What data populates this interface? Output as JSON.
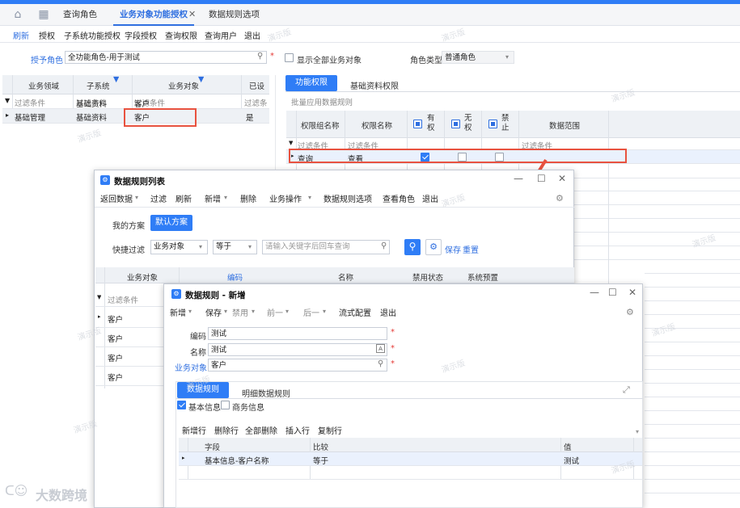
{
  "tabs": [
    {
      "label": "查询角色"
    },
    {
      "label": "业务对象功能授权"
    },
    {
      "label": "数据规则选项"
    }
  ],
  "toolbar": [
    "刷新",
    "授权",
    "子系统功能授权",
    "字段授权",
    "查询权限",
    "查询用户",
    "退出"
  ],
  "grant_role": {
    "label": "授予角色",
    "value": "全功能角色-用于测试"
  },
  "show_all_label": "显示全部业务对象",
  "role_type": {
    "label": "角色类型",
    "value": "普通角色"
  },
  "left_grid": {
    "headers": [
      "业务领域",
      "子系统",
      "业务对象",
      "已设"
    ],
    "filter_row": [
      "过滤条件",
      "过滤条件",
      "过滤条件",
      "过滤条"
    ],
    "rows": [
      [
        "基础资料",
        "客户",
        ""
      ],
      [
        "基础管理",
        "基础资料",
        "客户",
        "是"
      ]
    ]
  },
  "right_tabs": [
    "功能权限",
    "基础资料权限"
  ],
  "batch_label": "批量应用数据规则",
  "perm_grid": {
    "headers": [
      "权限组名称",
      "权限名称",
      "有权",
      "无权",
      "禁止",
      "数据范围"
    ],
    "filter": [
      "过滤条件",
      "过滤条件",
      "过滤条件"
    ],
    "row": [
      "查询",
      "查看"
    ]
  },
  "dialog1": {
    "title": "数据规则列表",
    "toolbar": [
      "返回数据",
      "过滤",
      "刷新",
      "新增",
      "删除",
      "业务操作",
      "数据规则选项",
      "查看角色",
      "退出"
    ],
    "scheme_tabs": [
      "我的方案",
      "默认方案"
    ],
    "quick_filter": "快捷过滤",
    "field_value": "业务对象",
    "op_value": "等于",
    "search_placeholder": "请输入关键字后回车查询",
    "save": "保存",
    "reset": "重置",
    "headers": [
      "业务对象",
      "编码",
      "名称",
      "禁用状态",
      "系统预置"
    ],
    "filter": "过滤条件",
    "rows": [
      "客户",
      "客户",
      "客户",
      "客户"
    ]
  },
  "dialog2": {
    "title": "数据规则 - 新增",
    "toolbar": [
      "新增",
      "保存",
      "禁用",
      "前一",
      "后一",
      "流式配置",
      "退出"
    ],
    "code": {
      "label": "编码",
      "value": "测试"
    },
    "name": {
      "label": "名称",
      "value": "测试"
    },
    "obj": {
      "label": "业务对象",
      "value": "客户"
    },
    "tabs": [
      "数据规则",
      "明细数据规则"
    ],
    "checks": [
      "基本信息",
      "商务信息"
    ],
    "ops": [
      "新增行",
      "删除行",
      "全部删除",
      "插入行",
      "复制行"
    ],
    "headers": [
      "字段",
      "比较",
      "值"
    ],
    "row": [
      "基本信息-客户名称",
      "等于",
      "测试"
    ]
  },
  "watermark": "演示版",
  "brand": "大数跨境",
  "colors": {
    "accent": "#2f7df6",
    "highlight": "#e8523f"
  }
}
